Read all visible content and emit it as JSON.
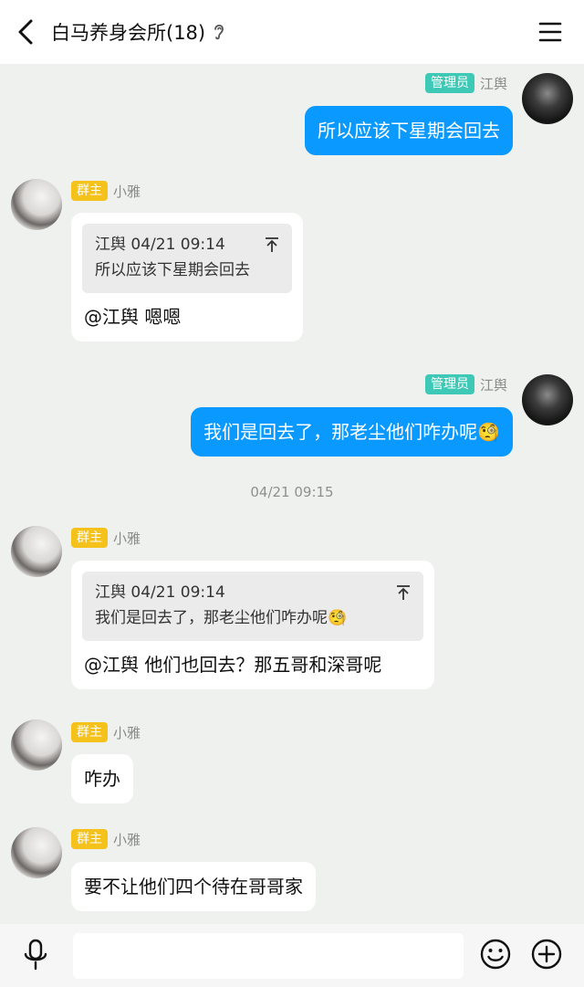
{
  "header": {
    "title": "白马养身会所(18)"
  },
  "messages": [
    {
      "sender": "江舆",
      "role": "管理员",
      "text": "所以应该下星期会回去"
    },
    {
      "sender": "小雅",
      "role": "群主",
      "quote_author_time": "江舆 04/21 09:14",
      "quote_text": "所以应该下星期会回去",
      "text": "@江舆 嗯嗯"
    },
    {
      "sender": "江舆",
      "role": "管理员",
      "text": "我们是回去了，那老尘他们咋办呢🧐"
    },
    {
      "timestamp": "04/21 09:15"
    },
    {
      "sender": "小雅",
      "role": "群主",
      "quote_author_time": "江舆 04/21 09:14",
      "quote_text": "我们是回去了，那老尘他们咋办呢🧐",
      "text": "@江舆 他们也回去？那五哥和深哥呢"
    },
    {
      "sender": "小雅",
      "role": "群主",
      "text": "咋办"
    },
    {
      "sender": "小雅",
      "role": "群主",
      "text": "要不让他们四个待在哥哥家"
    }
  ],
  "input": {
    "value": "",
    "placeholder": ""
  },
  "icons": {
    "back": "chevron-left-icon",
    "ear": "ear-icon",
    "menu": "hamburger-menu-icon",
    "quote_jump": "arrow-up-bar-icon",
    "mic": "microphone-icon",
    "emoji": "smiley-icon",
    "plus": "plus-circle-icon"
  },
  "colors": {
    "outgoing_bubble": "#0a99ff",
    "incoming_bubble": "#ffffff",
    "admin_badge": "#3ec9b7",
    "owner_badge": "#f4c21b",
    "chat_background": "#eef1ee"
  }
}
